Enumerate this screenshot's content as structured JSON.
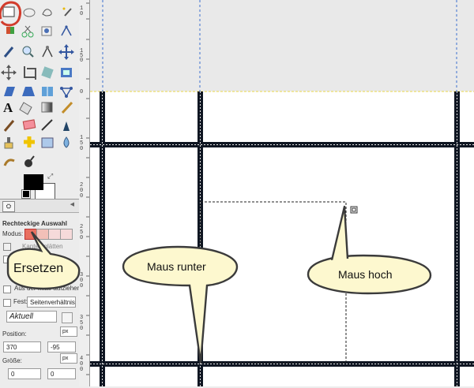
{
  "tool_options": {
    "title": "Rechteckige Auswahl",
    "mode_label": "Modus:",
    "smooth_label": "Kanten glätten",
    "from_center_label": "Aus der Mitte aufziehen",
    "fixed_label": "Fest:",
    "fixed_value": "Seitenverhältnis",
    "aspect_value": "Aktuell",
    "position_label": "Position:",
    "position_x": "370",
    "position_y": "-95",
    "position_unit": "px",
    "size_label": "Größe:",
    "size_w": "0",
    "size_h": "0",
    "size_unit": "px"
  },
  "callouts": {
    "ersetzen": "Ersetzen",
    "maus_runter": "Maus runter",
    "maus_hoch": "Maus hoch"
  },
  "icons": {
    "row1": [
      "rect-select-icon",
      "ellipse-select-icon",
      "free-select-icon",
      "fuzzy-select-icon"
    ],
    "row2": [
      "color-select-icon",
      "scissors-select-icon",
      "foreground-select-icon",
      "paths-icon"
    ],
    "row3": [
      "color-picker-icon",
      "zoom-icon",
      "measure-icon",
      "move-icon"
    ],
    "row4": [
      "align-icon",
      "crop-icon",
      "rotate-icon",
      "scale-icon"
    ],
    "row5": [
      "shear-icon",
      "perspective-icon",
      "flip-icon",
      "cage-icon"
    ],
    "row6": [
      "text-icon",
      "bucket-fill-icon",
      "blend-icon",
      "pencil-icon"
    ],
    "row7": [
      "paintbrush-icon",
      "eraser-icon",
      "airbrush-icon",
      "ink-icon"
    ],
    "row8": [
      "clone-icon",
      "heal-icon",
      "perspective-clone-icon",
      "blur-icon"
    ],
    "row9": [
      "smudge-icon",
      "dodge-burn-icon"
    ]
  },
  "colors": {
    "grid_line": "#0f1622",
    "highlight_circle": "#d23c2c",
    "callout_fill": "#fdf8cf",
    "callout_stroke": "#3b3b3b"
  }
}
